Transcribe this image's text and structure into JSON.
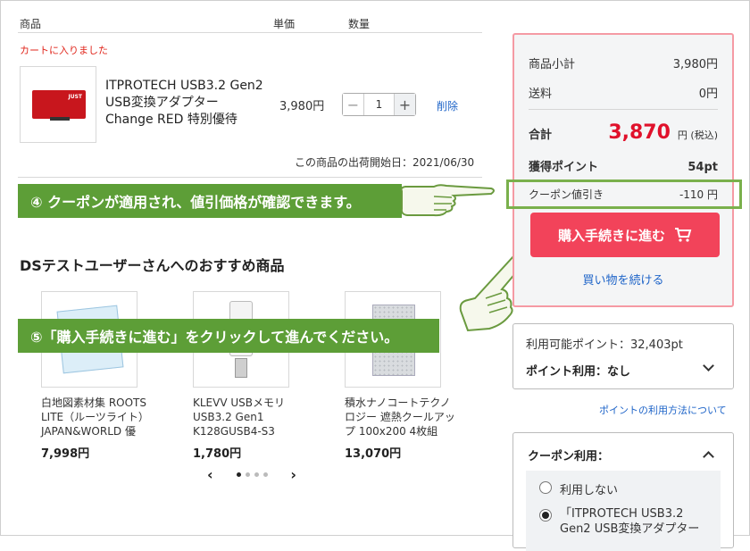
{
  "cart": {
    "header": {
      "product": "商品",
      "unit_price": "単価",
      "quantity": "数量"
    },
    "added_message": "カートに入りました",
    "item": {
      "name": "ITPROTECH USB3.2 Gen2 USB変換アダプター Change RED 特別優待",
      "price": "3,980円",
      "quantity": "1",
      "delete_label": "削除",
      "shipping_start": "この商品の出荷開始日：2021/06/30"
    }
  },
  "callouts": {
    "step4": "④ クーポンが適用され、値引価格が確認できます。",
    "step5": "⑤「購入手続きに進む」をクリックして進んでください。"
  },
  "recommend": {
    "title": "DSテストユーザーさんへのおすすめ商品",
    "items": [
      {
        "name": "白地図素材集 ROOTS LITE（ルーツライト） JAPAN&WORLD 優",
        "price": "7,998円"
      },
      {
        "name": "KLEVV USBメモリ USB3.2 Gen1 K128GUSB4-S3",
        "price": "1,780円"
      },
      {
        "name": "積水ナノコートテクノロジー 遮熱クールアップ 100x200 4枚組",
        "price": "13,070円"
      }
    ],
    "pager": {
      "prev": "‹",
      "next": "›"
    }
  },
  "summary": {
    "subtotal_label": "商品小計",
    "subtotal_value": "3,980円",
    "shipping_label": "送料",
    "shipping_value": "0円",
    "total_label": "合計",
    "total_value": "3,870",
    "total_unit": "円 (税込)",
    "points_label": "獲得ポイント",
    "points_value": "54pt",
    "coupon_label": "クーポン値引き",
    "coupon_value": "-110 円",
    "buy_button": "購入手続きに進む",
    "continue_link": "買い物を続ける"
  },
  "points": {
    "available": "利用可能ポイント：32,403pt",
    "usage": "ポイント利用：なし",
    "help_link": "ポイントの利用方法について"
  },
  "coupon_use": {
    "title": "クーポン利用：",
    "options": [
      "利用しない",
      "「ITPROTECH USB3.2 Gen2 USB変換アダプター"
    ]
  },
  "colors": {
    "accent": "#f2435a",
    "callout": "#5d9e37",
    "link": "#1e64c8",
    "price_red": "#e0112b"
  }
}
